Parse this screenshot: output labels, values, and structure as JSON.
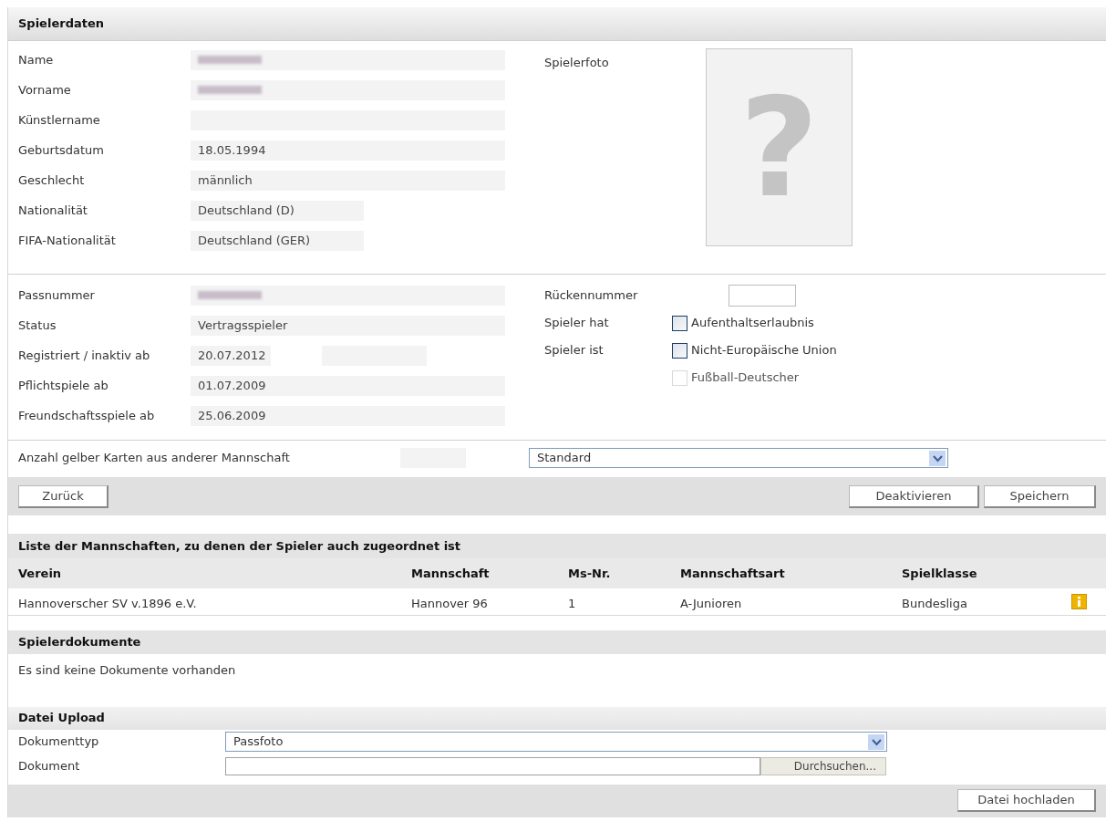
{
  "player_data": {
    "title": "Spielerdaten",
    "fields": [
      {
        "label": "Name",
        "blurred": true,
        "kind": "wide"
      },
      {
        "label": "Vorname",
        "blurred": true,
        "kind": "wide"
      },
      {
        "label": "Künstlername",
        "kind": "wide"
      },
      {
        "label": "Geburtsdatum",
        "value": "18.05.1994",
        "kind": "wide"
      },
      {
        "label": "Geschlecht",
        "value": "männlich",
        "kind": "wide"
      },
      {
        "label": "Nationalität",
        "value": "Deutschland (D)",
        "kind": "narrow"
      },
      {
        "label": "FIFA-Nationalität",
        "value": "Deutschland (GER)",
        "kind": "narrow"
      }
    ],
    "photo": {
      "label": "Spielerfoto",
      "placeholder": "?"
    }
  },
  "registration": {
    "fields": [
      {
        "label": "Passnummer",
        "blurred": true,
        "kind": "wide"
      },
      {
        "label": "Status",
        "value": "Vertragsspieler",
        "kind": "wide"
      },
      {
        "label": "Registriert / inaktiv ab",
        "value": "20.07.2012",
        "kind": "split"
      },
      {
        "label": "Pflichtspiele ab",
        "value": "01.07.2009",
        "kind": "wide"
      },
      {
        "label": "Freundschaftsspiele ab",
        "value": "25.06.2009",
        "kind": "wide"
      }
    ],
    "shirt_number": {
      "label": "Rückennummer"
    },
    "options": [
      {
        "label": "Spieler hat",
        "option": "Aufenthaltserlaubnis",
        "checked": false,
        "disabled": false
      },
      {
        "label": "Spieler ist",
        "option": "Nicht-Europäische Union",
        "checked": false,
        "disabled": false
      },
      {
        "option": "Fußball-Deutscher",
        "checked": false,
        "disabled": true
      }
    ]
  },
  "yellow_cards": {
    "label": "Anzahl gelber Karten aus anderer Mannschaft",
    "select": "Standard"
  },
  "actions": {
    "left": [
      "Zurück"
    ],
    "right": [
      "Deaktivieren",
      "Speichern"
    ]
  },
  "teams": {
    "title": "Liste der Mannschaften, zu denen der Spieler auch zugeordnet ist",
    "columns": [
      "Verein",
      "Mannschaft",
      "Ms-Nr.",
      "Mannschaftsart",
      "Spielklasse"
    ],
    "rows": [
      {
        "cells": [
          "Hannoverscher SV v.1896 e.V.",
          "Hannover 96",
          "1",
          "A-Junioren",
          "Bundesliga"
        ],
        "info": true
      }
    ]
  },
  "documents": {
    "title": "Spielerdokumente",
    "message": "Es sind keine Dokumente vorhanden"
  },
  "upload": {
    "title": "Datei Upload",
    "fields": [
      {
        "kind": "select",
        "label": "Dokumenttyp",
        "value": "Passfoto"
      },
      {
        "kind": "file",
        "label": "Dokument",
        "button": "Durchsuchen..."
      }
    ],
    "button": "Datei hochladen"
  }
}
